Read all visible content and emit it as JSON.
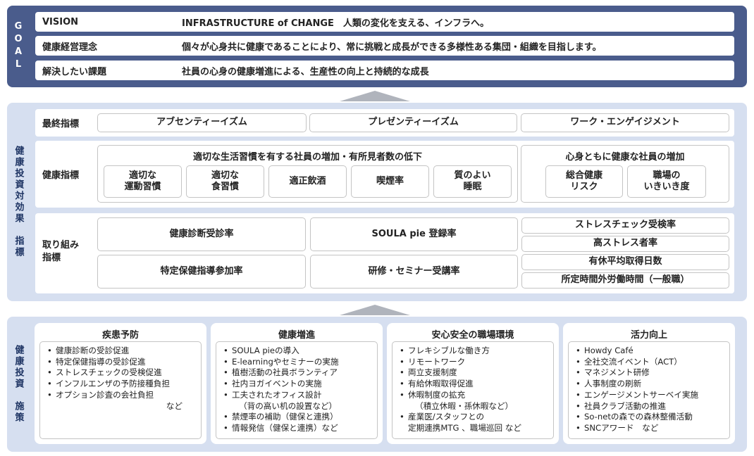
{
  "goal": {
    "side_label": "GOAL",
    "rows": [
      {
        "label": "VISION",
        "value": "INFRASTRUCTURE of CHANGE　人類の変化を支える、インフラへ。"
      },
      {
        "label": "健康経営理念",
        "value": "個々が心身共に健康であることにより、常に挑戦と成長ができる多様性ある集団・組織を目指します。"
      },
      {
        "label": "解決したい課題",
        "value": "社員の心身の健康増進による、生産性の向上と持続的な成長"
      }
    ]
  },
  "effect": {
    "side_label": "健康投資対効果　指標",
    "final": {
      "label": "最終指標",
      "items": [
        "アブセンティーイズム",
        "プレゼンティーイズム",
        "ワーク・エンゲイジメント"
      ]
    },
    "health": {
      "label": "健康指標",
      "group1": {
        "title": "適切な生活習慣を有する社員の増加・有所見者数の低下",
        "items": [
          [
            "適切な",
            "運動習慣"
          ],
          [
            "適切な",
            "食習慣"
          ],
          [
            "適正飲酒",
            ""
          ],
          [
            "喫煙率",
            ""
          ],
          [
            "質のよい",
            "睡眠"
          ]
        ]
      },
      "group2": {
        "title": "心身ともに健康な社員の増加",
        "items": [
          [
            "総合健康",
            "リスク"
          ],
          [
            "職場の",
            "いきいき度"
          ]
        ]
      }
    },
    "effort": {
      "label_line1": "取り組み",
      "label_line2": "指標",
      "left": [
        "健康診断受診率",
        "特定保健指導参加率"
      ],
      "middle": [
        "SOULA pie 登録率",
        "研修・セミナー受講率"
      ],
      "right": [
        "ストレスチェック受検率",
        "高ストレス者率",
        "有休平均取得日数",
        "所定時間外労働時間（一般職）"
      ]
    }
  },
  "measures": {
    "side_label": "健康投資　施策",
    "cards": [
      {
        "title": "疾患予防",
        "items": [
          "健康診断の受診促進",
          "特定保健指導の受診促進",
          "ストレスチェックの受検促進",
          "インフルエンザの予防接種負担",
          "オプション診査の会社負担"
        ],
        "tail": "など"
      },
      {
        "title": "健康増進",
        "items": [
          "SOULA pieの導入",
          "E-learningやセミナーの実施",
          "植樹活動の社員ボランティア",
          "社内ヨガイベントの実施",
          "工夫されたオフィス設計",
          "（背の高い机の設置など）",
          "禁煙率の補助（健保と連携）",
          "情報発信（健保と連携）など"
        ],
        "cont": [
          5
        ]
      },
      {
        "title": "安心安全の職場環境",
        "items": [
          "フレキシブルな働き方",
          "リモートワーク",
          "両立支援制度",
          "有給休暇取得促進",
          "休暇制度の拡充",
          "（積立休暇・孫休暇など）",
          "産業医/スタッフとの",
          "定期連携MTG 、職場巡回 など"
        ],
        "cont": [
          5,
          7
        ]
      },
      {
        "title": "活力向上",
        "items": [
          "Howdy Café",
          "全社交流イベント（ACT）",
          "マネジメント研修",
          "人事制度の刷新",
          "エンゲージメントサーベイ実施",
          "社員クラブ活動の推進",
          "So-netの森での森林整備活動",
          "SNCアワード　など"
        ]
      }
    ]
  }
}
